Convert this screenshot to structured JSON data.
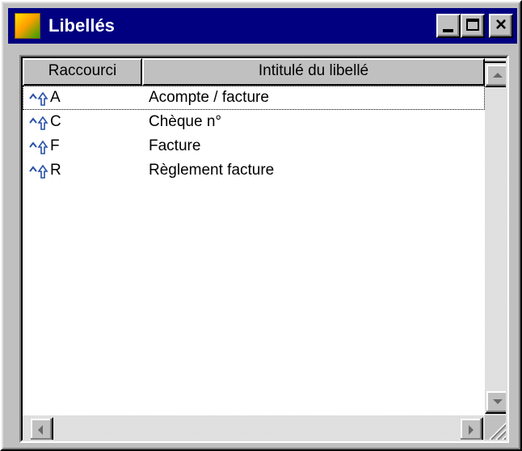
{
  "window": {
    "title": "Libellés",
    "controls": {
      "minimize": "minimize",
      "maximize": "maximize",
      "close": "×"
    }
  },
  "table": {
    "headers": {
      "shortcut": "Raccourci",
      "label": "Intitulé du libellé"
    },
    "rows": [
      {
        "key": "A",
        "label": "Acompte / facture"
      },
      {
        "key": "C",
        "label": "Chèque n°"
      },
      {
        "key": "F",
        "label": "Facture"
      },
      {
        "key": "R",
        "label": "Règlement facture"
      }
    ],
    "shortcut_icon": "ctrl-shift-icon",
    "selected_row": 0
  },
  "colors": {
    "titlebar": "#000080",
    "face": "#c0c0c0",
    "shortcut_icon": "#2850a8"
  }
}
